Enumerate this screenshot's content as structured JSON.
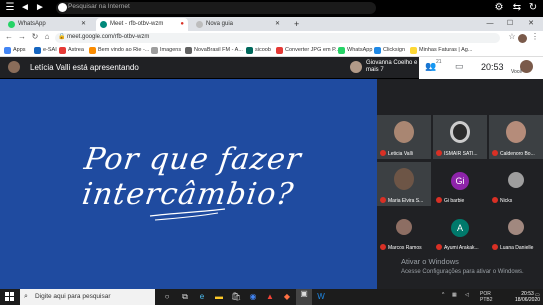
{
  "topbar": {
    "search_placeholder": "Pesquisar na Internet"
  },
  "tabs": [
    {
      "label": "WhatsApp",
      "color": "#25d366"
    },
    {
      "label": "Meet - rfb-otbv-wzm",
      "color": "#00897b"
    },
    {
      "label": "Nova guia",
      "color": "#5f6368"
    }
  ],
  "address": {
    "url": "meet.google.com/rfb-otbv-wzm"
  },
  "bookmarks": [
    {
      "label": "Apps",
      "color": "#4285f4"
    },
    {
      "label": "e-SAI",
      "color": "#1565c0"
    },
    {
      "label": "Astrea",
      "color": "#e53935"
    },
    {
      "label": "Bem vindo ao Rie -...",
      "color": "#fb8c00"
    },
    {
      "label": "Imagens",
      "color": "#9e9e9e"
    },
    {
      "label": "NovaBrasil FM - A...",
      "color": "#616161"
    },
    {
      "label": "sicoob",
      "color": "#00695c"
    },
    {
      "label": "Converter JPG em P...",
      "color": "#e53935"
    },
    {
      "label": "WhatsApp",
      "color": "#25d366"
    },
    {
      "label": "Clicksign",
      "color": "#1e88e5"
    },
    {
      "label": "Minhas Faturas | Ag...",
      "color": "#fdd835"
    }
  ],
  "meet": {
    "presenting_label": "Letícia Valli está apresentando",
    "also_label": "Giovanna Coelho e mais 7",
    "people_count": "21",
    "clock": "20:53",
    "you_label": "Você"
  },
  "slide": {
    "title": "Por que fazer intercâmbio?"
  },
  "participants": [
    {
      "name": "Leticia Valli",
      "kind": "face",
      "color": "#a98672"
    },
    {
      "name": "ISMAIR SATI...",
      "kind": "face",
      "color": "#2b2b2b"
    },
    {
      "name": "Caldenoro Bo...",
      "kind": "face",
      "color": "#b58c7a"
    },
    {
      "name": "Maria Elvira S...",
      "kind": "face",
      "color": "#6d5546"
    },
    {
      "name": "Gi barbie",
      "kind": "letter",
      "letter": "Gi",
      "color": "#8e24aa"
    },
    {
      "name": "Nicks",
      "kind": "face",
      "color": "#9e9e9e"
    },
    {
      "name": "Marcos Ramos",
      "kind": "face",
      "color": "#8d6e63"
    },
    {
      "name": "Ayumi Arakak...",
      "kind": "letter",
      "letter": "A",
      "color": "#00796b"
    },
    {
      "name": "Luana Danielle",
      "kind": "face",
      "color": "#a1887f"
    }
  ],
  "watermark": {
    "title": "Ativar o Windows",
    "subtitle": "Acesse Configurações para ativar o Windows."
  },
  "taskbar": {
    "search_placeholder": "Digite aqui para pesquisar",
    "lang": "POR",
    "layout": "PTB2",
    "time": "20:53",
    "date": "18/06/2020"
  }
}
